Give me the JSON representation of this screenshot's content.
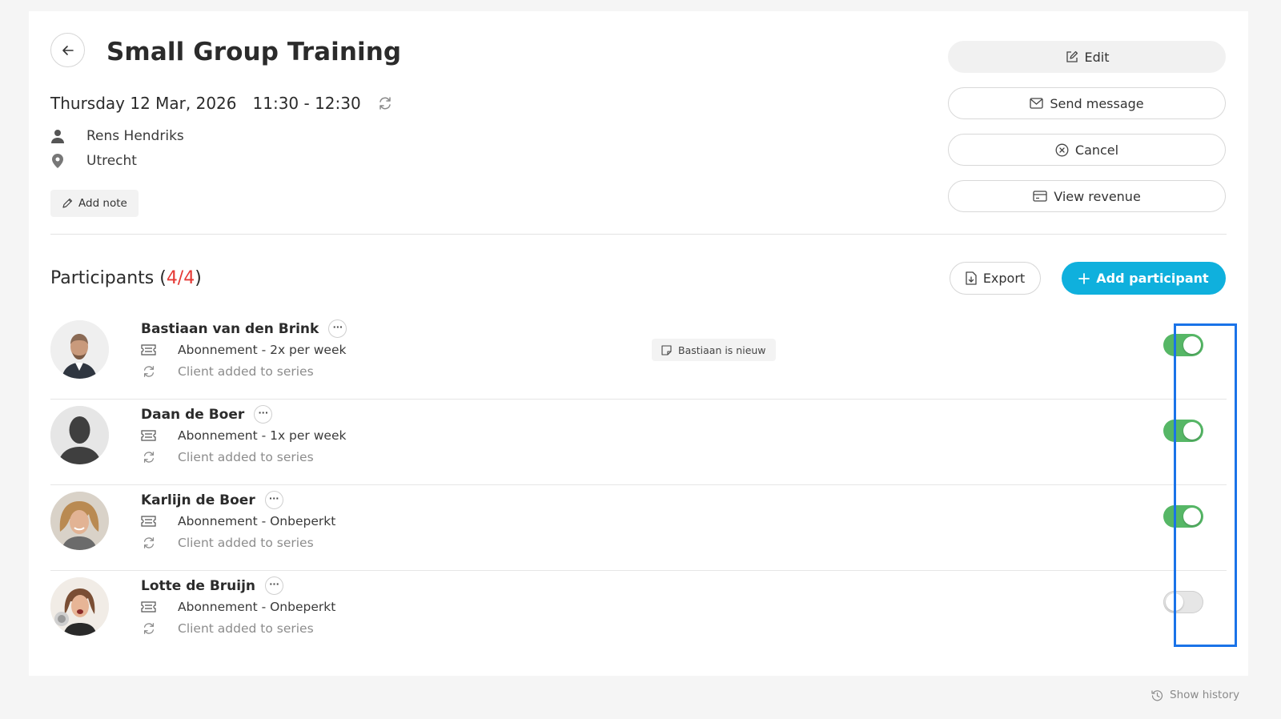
{
  "session": {
    "title": "Small Group Training",
    "date": "Thursday 12 Mar, 2026",
    "time": "11:30 - 12:30",
    "trainer": "Rens Hendriks",
    "location": "Utrecht",
    "add_note_label": "Add note"
  },
  "actions": {
    "edit": "Edit",
    "send_message": "Send message",
    "cancel": "Cancel",
    "view_revenue": "View revenue"
  },
  "participants": {
    "label": "Participants",
    "count": "4/4",
    "export_label": "Export",
    "add_label": "Add participant",
    "list": [
      {
        "name": "Bastiaan van den Brink",
        "plan": "Abonnement - 2x per week",
        "series": "Client added to series",
        "note": "Bastiaan is nieuw",
        "enabled": true
      },
      {
        "name": "Daan de Boer",
        "plan": "Abonnement - 1x per week",
        "series": "Client added to series",
        "enabled": true
      },
      {
        "name": "Karlijn de Boer",
        "plan": "Abonnement - Onbeperkt",
        "series": "Client added to series",
        "enabled": true
      },
      {
        "name": "Lotte de Bruijn",
        "plan": "Abonnement - Onbeperkt",
        "series": "Client added to series",
        "enabled": false
      }
    ]
  },
  "footer": {
    "show_history": "Show history"
  },
  "colors": {
    "accent": "#0fb0dd",
    "toggle_on": "#56b766",
    "count": "#e53935",
    "highlight": "#1a73e8"
  },
  "icons": [
    "back-arrow-icon",
    "repeat-icon",
    "person-icon",
    "location-pin-icon",
    "pencil-icon",
    "edit-icon",
    "mail-icon",
    "cancel-circle-icon",
    "revenue-icon",
    "export-file-icon",
    "plus-icon",
    "more-dots-icon",
    "ticket-icon",
    "note-icon",
    "history-icon"
  ]
}
